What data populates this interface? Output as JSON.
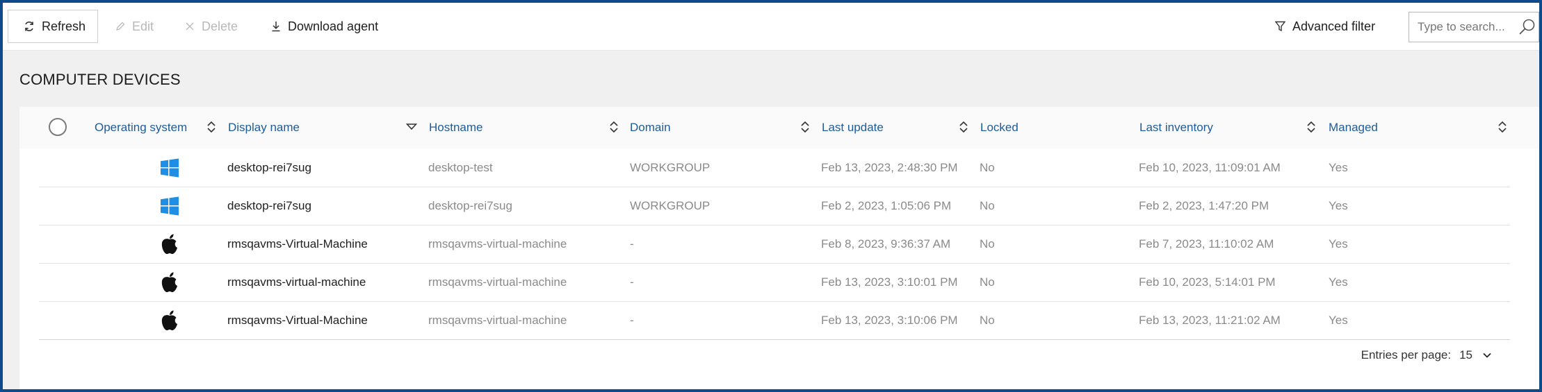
{
  "toolbar": {
    "refresh_label": "Refresh",
    "edit_label": "Edit",
    "delete_label": "Delete",
    "download_label": "Download agent",
    "advanced_filter_label": "Advanced filter",
    "search_placeholder": "Type to search..."
  },
  "section": {
    "title": "COMPUTER DEVICES"
  },
  "table": {
    "columns": [
      "Operating system",
      "Display name",
      "Hostname",
      "Domain",
      "Last update",
      "Locked",
      "Last inventory",
      "Managed"
    ],
    "rows": [
      {
        "os": "windows-icon",
        "display_name": "desktop-rei7sug",
        "hostname": "desktop-test",
        "domain": "WORKGROUP",
        "last_update": "Feb 13, 2023, 2:48:30 PM",
        "locked": "No",
        "last_inventory": "Feb 10, 2023, 11:09:01 AM",
        "managed": "Yes"
      },
      {
        "os": "windows-icon",
        "display_name": "desktop-rei7sug",
        "hostname": "desktop-rei7sug",
        "domain": "WORKGROUP",
        "last_update": "Feb 2, 2023, 1:05:06 PM",
        "locked": "No",
        "last_inventory": "Feb 2, 2023, 1:47:20 PM",
        "managed": "Yes"
      },
      {
        "os": "apple-icon",
        "display_name": "rmsqavms-Virtual-Machine",
        "hostname": "rmsqavms-virtual-machine",
        "domain": "-",
        "last_update": "Feb 8, 2023, 9:36:37 AM",
        "locked": "No",
        "last_inventory": "Feb 7, 2023, 11:10:02 AM",
        "managed": "Yes"
      },
      {
        "os": "apple-icon",
        "display_name": "rmsqavms-virtual-machine",
        "hostname": "rmsqavms-virtual-machine",
        "domain": "-",
        "last_update": "Feb 13, 2023, 3:10:01 PM",
        "locked": "No",
        "last_inventory": "Feb 10, 2023, 5:14:01 PM",
        "managed": "Yes"
      },
      {
        "os": "apple-icon",
        "display_name": "rmsqavms-Virtual-Machine",
        "hostname": "rmsqavms-virtual-machine",
        "domain": "-",
        "last_update": "Feb 13, 2023, 3:10:06 PM",
        "locked": "No",
        "last_inventory": "Feb 13, 2023, 11:21:02 AM",
        "managed": "Yes"
      }
    ]
  },
  "footer": {
    "entries_label": "Entries per page:",
    "entries_value": "15"
  },
  "colors": {
    "accent": "#1e5b99",
    "frame_border": "#0f4a8a",
    "windows_blue": "#1f8fe5"
  }
}
